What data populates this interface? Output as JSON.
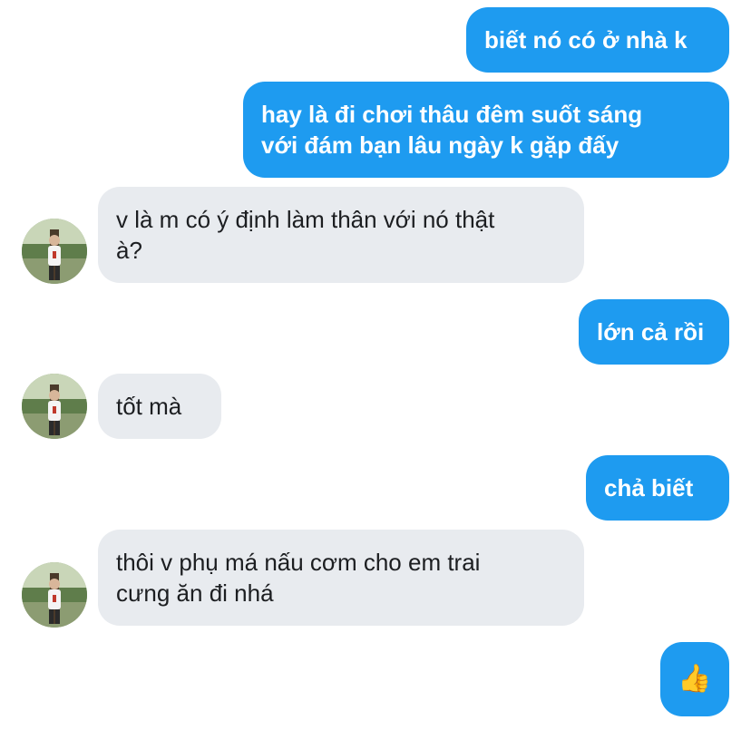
{
  "conversation": {
    "messages": [
      {
        "side": "out",
        "text": "biết nó có ở nhà k"
      },
      {
        "side": "out",
        "text": "hay là đi chơi thâu đêm suốt sáng\nvới đám bạn lâu ngày k gặp đấy"
      },
      {
        "side": "in",
        "text": "v là m có ý định làm thân với nó thật\nà?"
      },
      {
        "side": "out",
        "text": "lớn cả rồi"
      },
      {
        "side": "in",
        "text": "tốt mà"
      },
      {
        "side": "out",
        "text": "chả biết"
      },
      {
        "side": "in",
        "text": "thôi v phụ má nấu cơm cho em trai\ncưng ăn đi nhá"
      },
      {
        "side": "out",
        "reaction": "thumbs-up",
        "text": "👍"
      }
    ]
  },
  "icons": {
    "avatar": "contact-photo",
    "reaction": "thumbs-up-icon"
  },
  "colors": {
    "outgoing_bubble": "#1e9bf0",
    "incoming_bubble": "#e8ebef",
    "incoming_text": "#1c1e21",
    "outgoing_text": "#ffffff"
  }
}
